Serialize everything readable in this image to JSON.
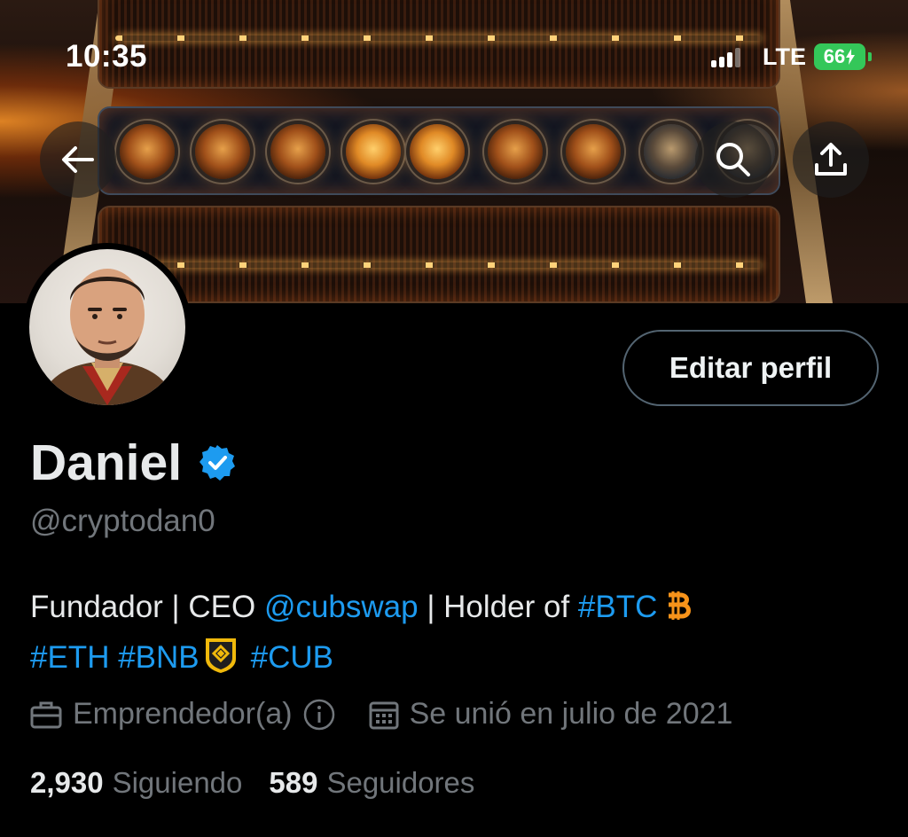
{
  "status_bar": {
    "time": "10:35",
    "network": "LTE",
    "battery": "66"
  },
  "header": {
    "back_icon": "arrow-left-icon",
    "search_icon": "search-icon",
    "share_icon": "share-icon"
  },
  "profile": {
    "name": "Daniel",
    "handle": "@cryptodan0",
    "verified_icon": "verified-badge-icon",
    "edit_button": "Editar perfil",
    "bio": {
      "part1": "Fundador | CEO ",
      "mention": "@cubswap",
      "part2": " | Holder of ",
      "tag_btc": "#BTC",
      "tag_eth": "#ETH",
      "tag_bnb": "#BNB",
      "tag_cub": "#CUB"
    },
    "category": "Emprendedor(a)",
    "joined": "Se unió en julio de 2021",
    "following_count": "2,930",
    "following_label": "Siguiendo",
    "followers_count": "589",
    "followers_label": "Seguidores"
  },
  "colors": {
    "accent": "#1d9bf0",
    "bitcoin": "#f7931a",
    "battery": "#34c759",
    "muted": "#71767b"
  }
}
